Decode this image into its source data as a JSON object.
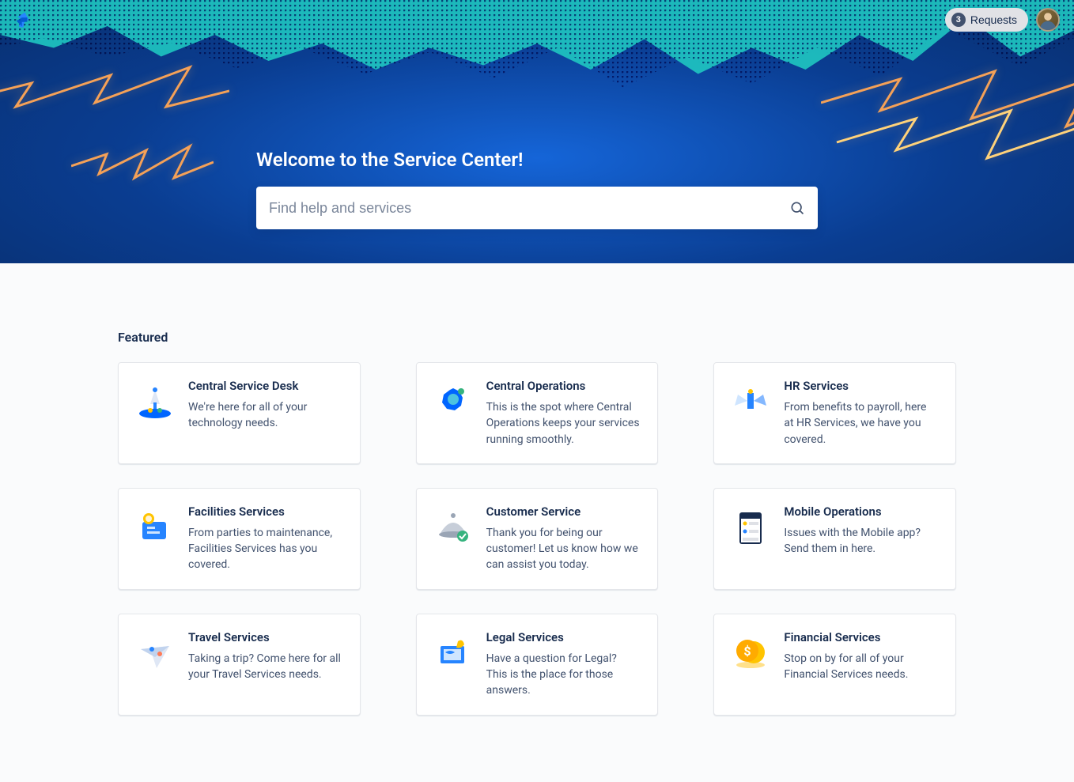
{
  "topbar": {
    "requests_count": "3",
    "requests_label": "Requests"
  },
  "hero": {
    "title": "Welcome to the Service Center!",
    "search_placeholder": "Find help and services"
  },
  "featured": {
    "title": "Featured",
    "cards": [
      {
        "title": "Central Service Desk",
        "desc": "We're here for all of your technology needs."
      },
      {
        "title": "Central Operations",
        "desc": "This is the spot where Central Operations keeps your services running smoothly."
      },
      {
        "title": "HR Services",
        "desc": "From benefits to payroll, here at HR Services, we have you covered."
      },
      {
        "title": "Facilities Services",
        "desc": "From parties to maintenance, Facilities Services has you covered."
      },
      {
        "title": "Customer Service",
        "desc": "Thank you for being our customer! Let us know how we can assist you today."
      },
      {
        "title": "Mobile Operations",
        "desc": "Issues with the Mobile app? Send them in here."
      },
      {
        "title": "Travel Services",
        "desc": "Taking a trip? Come here for all your Travel Services needs."
      },
      {
        "title": "Legal Services",
        "desc": "Have a question for Legal? This is the place for those answers."
      },
      {
        "title": "Financial Services",
        "desc": "Stop on by for all of your Financial Services needs."
      }
    ]
  }
}
